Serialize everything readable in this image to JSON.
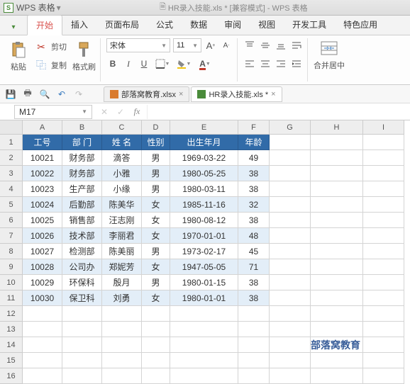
{
  "app": {
    "logo_text": "S",
    "name": "WPS 表格",
    "title_doc": "HR录入技能.xls * [兼容模式] - WPS 表格"
  },
  "menu": {
    "file_glyph": "▾",
    "items": [
      "开始",
      "插入",
      "页面布局",
      "公式",
      "数据",
      "审阅",
      "视图",
      "开发工具",
      "特色应用"
    ]
  },
  "ribbon": {
    "paste": "粘贴",
    "cut": "剪切",
    "copy": "复制",
    "format_painter": "格式刷",
    "font_name": "宋体",
    "font_size": "11",
    "merge_center": "合并居中"
  },
  "doctabs": [
    {
      "name": "部落窝教育.xlsx",
      "active": false
    },
    {
      "name": "HR录入技能.xls *",
      "active": true
    }
  ],
  "namebox": "M17",
  "columns": [
    "A",
    "B",
    "C",
    "D",
    "E",
    "F",
    "G",
    "H",
    "I"
  ],
  "row_numbers": [
    1,
    2,
    3,
    4,
    5,
    6,
    7,
    8,
    9,
    10,
    11,
    12,
    13,
    14,
    15,
    16
  ],
  "table": {
    "headers": [
      "工号",
      "部 门",
      "姓 名",
      "性别",
      "出生年月",
      "年龄"
    ],
    "rows": [
      [
        "10021",
        "财务部",
        "滴答",
        "男",
        "1969-03-22",
        "49"
      ],
      [
        "10022",
        "财务部",
        "小雅",
        "男",
        "1980-05-25",
        "38"
      ],
      [
        "10023",
        "生产部",
        "小缘",
        "男",
        "1980-03-11",
        "38"
      ],
      [
        "10024",
        "后勤部",
        "陈美华",
        "女",
        "1985-11-16",
        "32"
      ],
      [
        "10025",
        "销售部",
        "汪志刚",
        "女",
        "1980-08-12",
        "38"
      ],
      [
        "10026",
        "技术部",
        "李丽君",
        "女",
        "1970-01-01",
        "48"
      ],
      [
        "10027",
        "检测部",
        "陈美丽",
        "男",
        "1973-02-17",
        "45"
      ],
      [
        "10028",
        "公司办",
        "郑妮芳",
        "女",
        "1947-05-05",
        "71"
      ],
      [
        "10029",
        "环保科",
        "殷月",
        "男",
        "1980-01-15",
        "38"
      ],
      [
        "10030",
        "保卫科",
        "刘勇",
        "女",
        "1980-01-01",
        "38"
      ]
    ]
  },
  "watermark": "部落窝教育"
}
